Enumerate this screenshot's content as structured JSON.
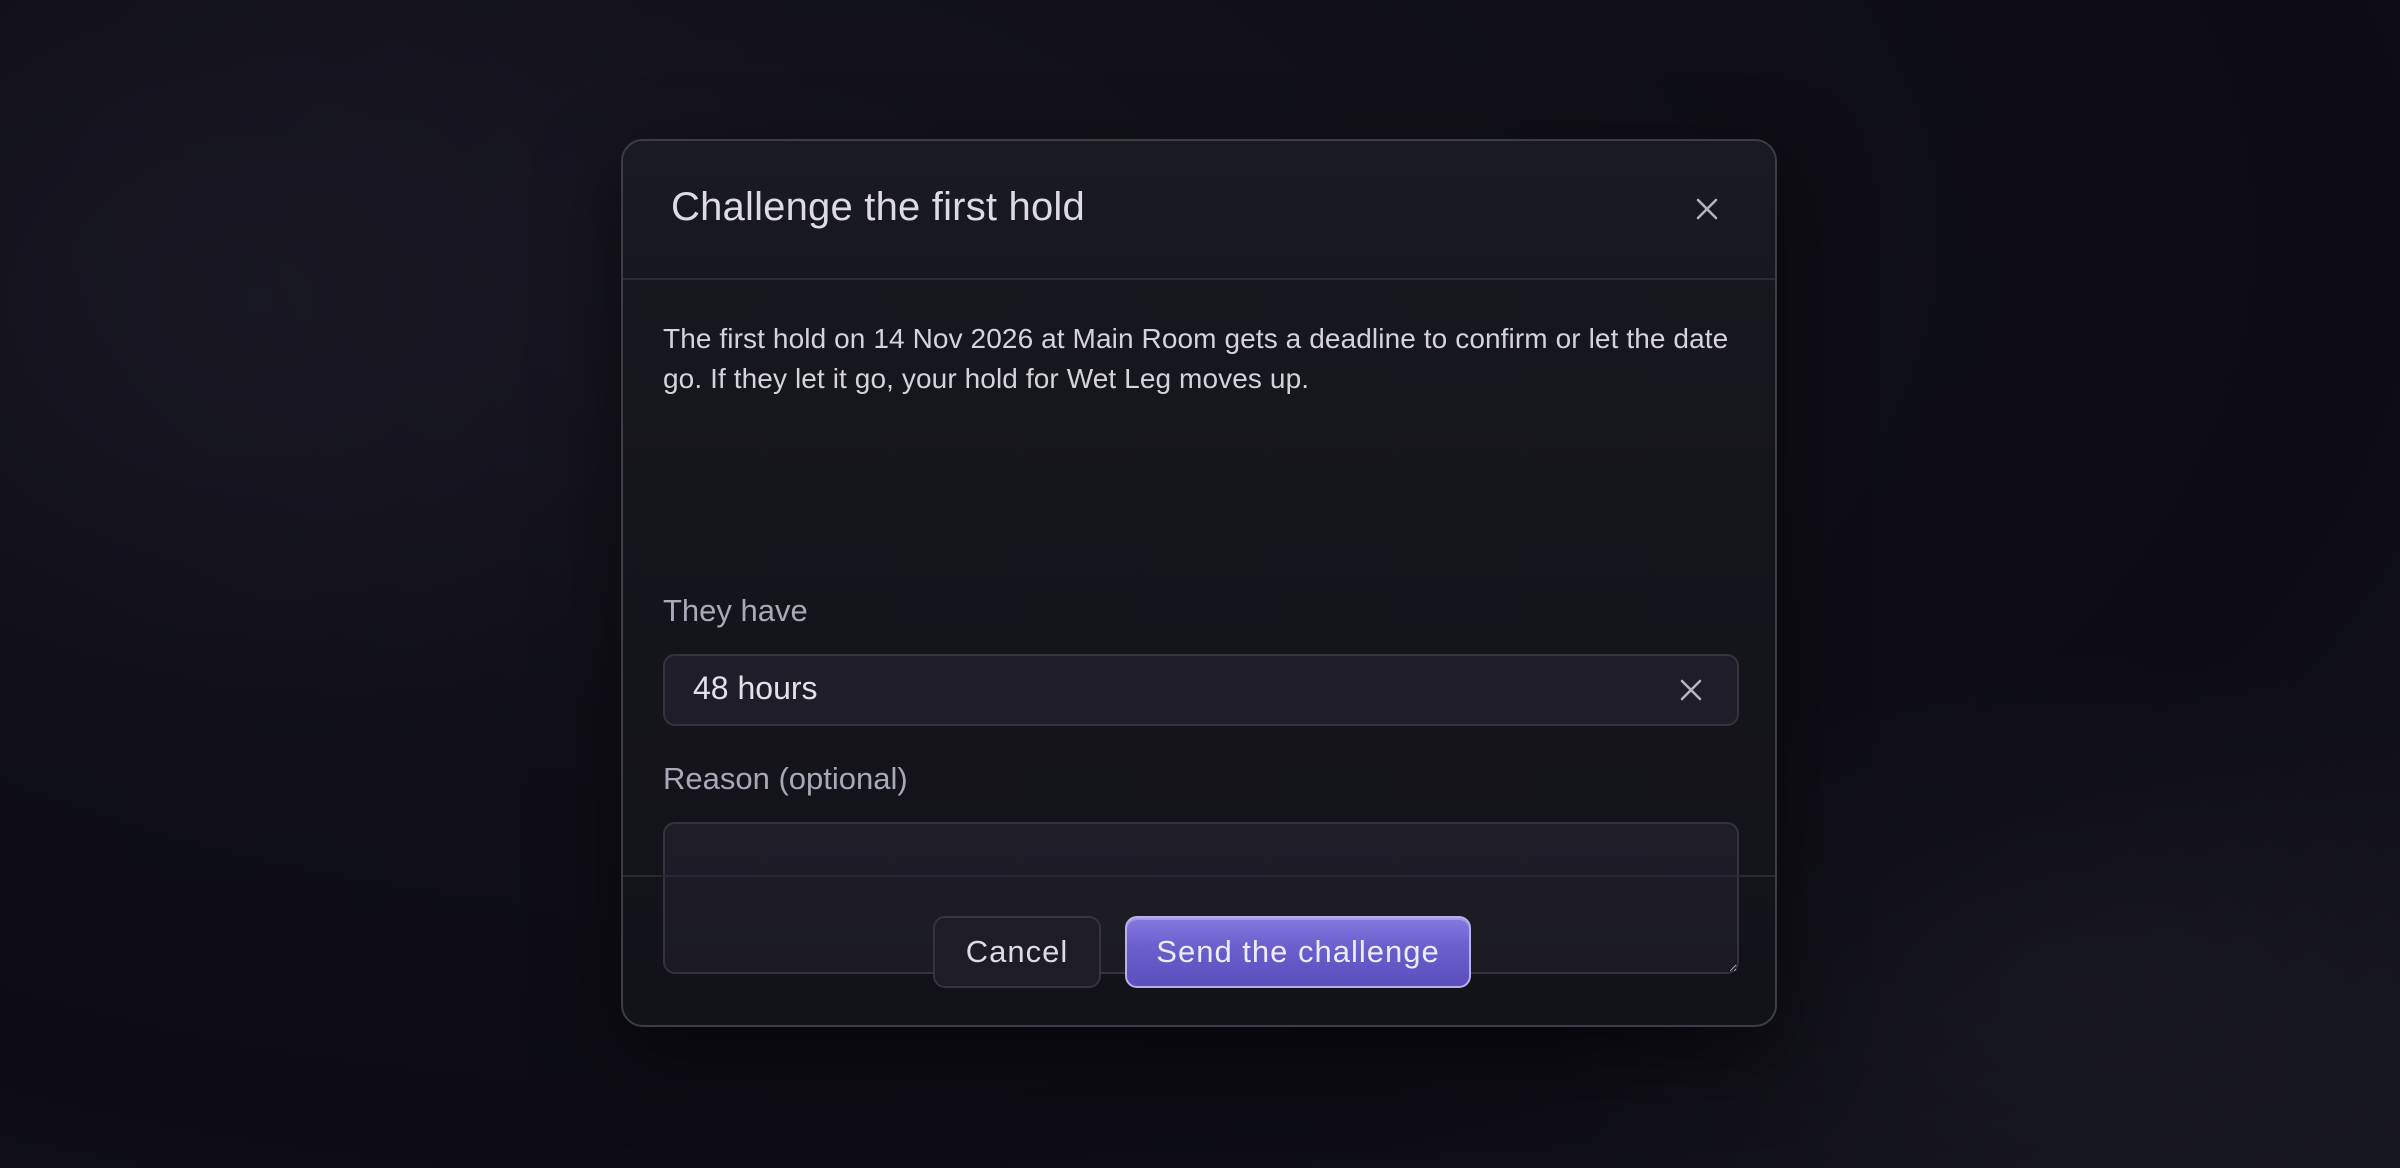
{
  "dialog": {
    "title": "Challenge the first hold",
    "description": "The first hold on 14 Nov 2026 at Main Room gets a deadline to confirm or let the date go. If they let it go, your hold for Wet Leg moves up.",
    "deadline_label": "They have",
    "deadline_value": "48 hours",
    "reason_label": "Reason (optional)",
    "reason_value": "",
    "cancel_label": "Cancel",
    "submit_label": "Send the challenge"
  },
  "colors": {
    "background": "#0f0e16",
    "panel": "#16161e",
    "accent": "#6f62d2",
    "text": "#dcdbe4",
    "muted": "#a9a8b6"
  },
  "icons": {
    "close": "close-icon",
    "clear": "clear-icon"
  }
}
